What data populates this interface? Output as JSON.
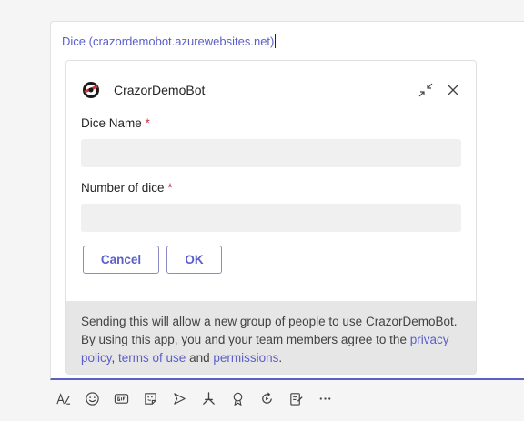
{
  "compose": {
    "link_text": "Dice (crazordemobot.azurewebsites.net)"
  },
  "card": {
    "bot_name": "CrazorDemoBot",
    "fields": [
      {
        "label": "Dice Name",
        "required_mark": "*",
        "value": ""
      },
      {
        "label": "Number of dice",
        "required_mark": "*",
        "value": ""
      }
    ],
    "cancel_label": "Cancel",
    "ok_label": "OK",
    "footer": {
      "text_before": "Sending this will allow a new group of people to use CrazorDemoBot. By using this app, you and your team members agree to the ",
      "privacy_link": "privacy policy",
      "sep": ", ",
      "terms_link": "terms of use",
      "and": " and ",
      "permissions_link": "permissions",
      "end": "."
    }
  },
  "toolbar": {
    "icons": [
      "format-icon",
      "emoji-icon",
      "gif-icon",
      "sticker-icon",
      "meet-icon",
      "stream-icon",
      "praise-icon",
      "loop-icon",
      "more-apps-icon",
      "more-options-icon"
    ]
  },
  "colors": {
    "accent": "#5b5fc7",
    "required": "#c4314b",
    "footer_bg": "#e6e6e6",
    "input_bg": "#f0f0f0"
  }
}
